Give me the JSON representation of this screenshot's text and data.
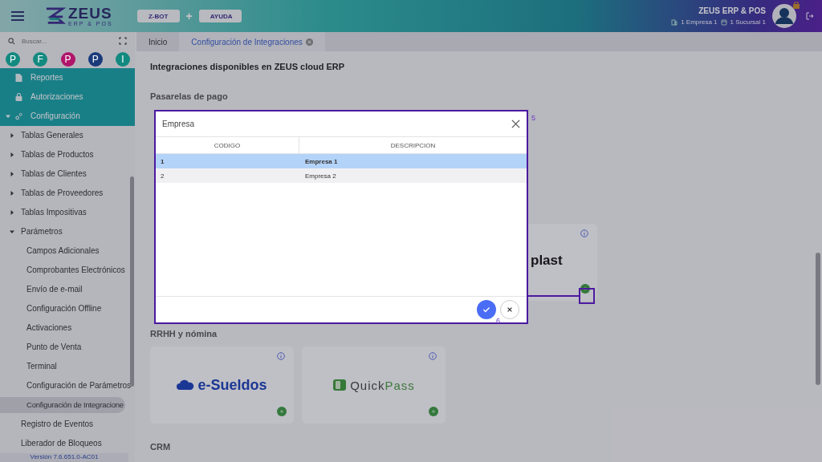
{
  "header": {
    "logo_title": "ZEUS",
    "logo_subtitle": "ERP & POS",
    "buttons": [
      {
        "label": "Z-BOT"
      },
      {
        "label": "AYUDA"
      }
    ],
    "joiner": "+",
    "company": "ZEUS ERP & POS",
    "branch_company": "1 Empresa 1",
    "branch_office": "1 Sucursal 1"
  },
  "sidebar": {
    "search": {
      "placeholder": "Buscar..."
    },
    "shortcuts": [
      {
        "label": "P",
        "color": "#138a80"
      },
      {
        "label": "F",
        "color": "#138a80"
      },
      {
        "label": "P",
        "color": "#b0156a"
      },
      {
        "label": "P",
        "color": "#1a3a7a"
      },
      {
        "label": "I",
        "color": "#138a80"
      }
    ],
    "menu": [
      {
        "label": "Reportes",
        "selected": false
      },
      {
        "label": "Autorizaciones",
        "selected": false
      },
      {
        "label": "Configuración",
        "expanded": true,
        "children": [
          {
            "label": "Tablas Generales",
            "expanded": false
          },
          {
            "label": "Tablas de Productos",
            "expanded": false
          },
          {
            "label": "Tablas de Clientes",
            "expanded": false
          },
          {
            "label": "Tablas de Proveedores",
            "expanded": false
          },
          {
            "label": "Tablas Impositivas",
            "expanded": false
          },
          {
            "label": "Parámetros",
            "expanded": true,
            "children": [
              {
                "label": "Campos Adicionales",
                "selected": false
              },
              {
                "label": "Comprobantes Electrónicos",
                "selected": false
              },
              {
                "label": "Envío de e-mail",
                "selected": false
              },
              {
                "label": "Configuración Offline",
                "selected": false
              },
              {
                "label": "Activaciones",
                "selected": false
              },
              {
                "label": "Punto de Venta",
                "selected": false
              },
              {
                "label": "Terminal",
                "selected": false
              },
              {
                "label": "Configuración de Parámetros",
                "selected": false
              },
              {
                "label": "Configuración de Integracione",
                "selected": true
              }
            ]
          },
          {
            "label": "Registro de Eventos",
            "selected": false
          },
          {
            "label": "Liberador de Bloqueos",
            "selected": false
          }
        ]
      }
    ],
    "version_label": "Versión",
    "version": "7.6.651.0-AC01"
  },
  "tabs": [
    {
      "label": "Inicio",
      "selected": false,
      "closable": false
    },
    {
      "label": "Configuración de Integraciones",
      "selected": true,
      "closable": true
    }
  ],
  "content": {
    "title": "Integraciones disponibles en ZEUS cloud ERP",
    "sections": [
      {
        "title": "Pasarelas de pago"
      },
      {
        "cards": [
          {
            "logo": "plast"
          }
        ]
      },
      {
        "title": "RRHH y nómina",
        "cards": [
          {
            "kind": "cloud",
            "logo": "e-Sueldos"
          },
          {
            "kind": "quickpass",
            "logo": "Quick",
            "logo_accent": "Pass"
          }
        ]
      },
      {
        "title": "CRM"
      }
    ]
  },
  "dialog": {
    "title": "Empresa",
    "columns": [
      "CODIGO",
      "DESCRIPCION"
    ],
    "rows": [
      {
        "cells": [
          "1",
          "Empresa 1"
        ],
        "selected": true
      },
      {
        "cells": [
          "2",
          "Empresa 2"
        ],
        "selected": false
      }
    ]
  },
  "tour": {
    "step_labels": [
      "5",
      "6"
    ]
  }
}
